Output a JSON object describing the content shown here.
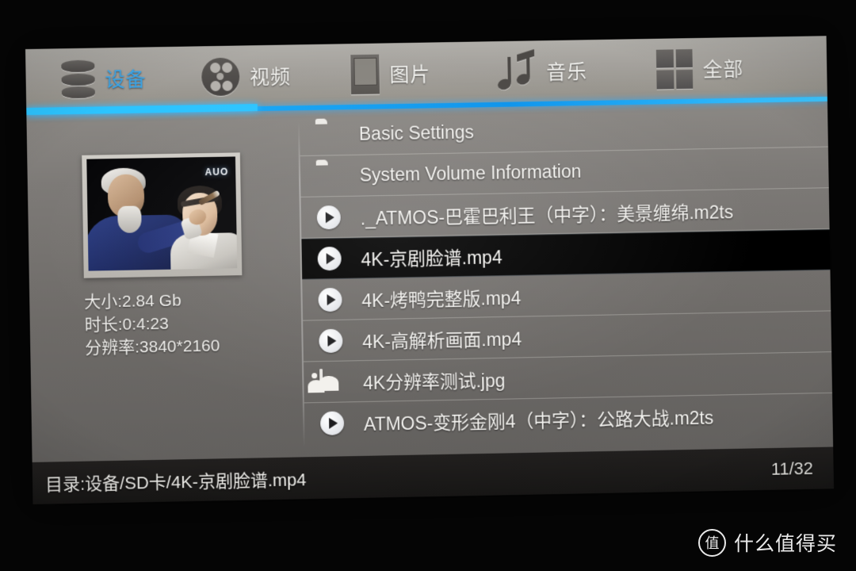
{
  "nav": {
    "items": [
      {
        "label": "设备",
        "icon": "device-icon",
        "active": true
      },
      {
        "label": "视频",
        "icon": "film-reel-icon",
        "active": false
      },
      {
        "label": "图片",
        "icon": "photo-frame-icon",
        "active": false
      },
      {
        "label": "音乐",
        "icon": "music-note-icon",
        "active": false
      },
      {
        "label": "全部",
        "icon": "grid-icon",
        "active": false
      }
    ]
  },
  "preview": {
    "thumbnail_watermark": "AUO",
    "size": "大小:2.84 Gb",
    "duration": "时长:0:4:23",
    "resolution": "分辨率:3840*2160"
  },
  "files": [
    {
      "name": "Basic Settings",
      "icon": "folder-icon",
      "selected": false
    },
    {
      "name": "System Volume Information",
      "icon": "folder-icon",
      "selected": false
    },
    {
      "name": "._ATMOS-巴霍巴利王（中字）：美景缠绵.m2ts",
      "icon": "play-icon",
      "selected": false
    },
    {
      "name": "4K-京剧脸谱.mp4",
      "icon": "play-icon",
      "selected": true
    },
    {
      "name": "4K-烤鸭完整版.mp4",
      "icon": "play-icon",
      "selected": false
    },
    {
      "name": "4K-高解析画面.mp4",
      "icon": "play-icon",
      "selected": false
    },
    {
      "name": "4K分辨率测试.jpg",
      "icon": "image-icon",
      "selected": false
    },
    {
      "name": "ATMOS-变形金刚4（中字）：公路大战.m2ts",
      "icon": "play-icon",
      "selected": false
    }
  ],
  "status": {
    "path": "目录:设备/SD卡/4K-京剧脸谱.mp4",
    "page": "11/32"
  },
  "watermark": {
    "badge": "值",
    "text": "什么值得买"
  },
  "colors": {
    "accent": "#2cc4ff",
    "active_tab_text": "#3aa9ef",
    "panel_bg": "#6e6b68",
    "selected_row_bg": "#000000",
    "status_bar_bg": "#1a1918"
  }
}
